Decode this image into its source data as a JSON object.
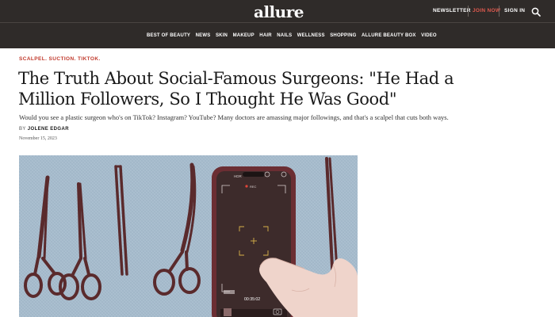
{
  "header": {
    "logo": "allure",
    "newsletter_label": "NEWSLETTER",
    "join_label": "JOIN NOW",
    "signin_label": "SIGN IN"
  },
  "nav": {
    "items": [
      "BEST OF BEAUTY",
      "NEWS",
      "SKIN",
      "MAKEUP",
      "HAIR",
      "NAILS",
      "WELLNESS",
      "SHOPPING",
      "ALLURE BEAUTY BOX",
      "VIDEO"
    ]
  },
  "article": {
    "kicker": "SCALPEL. SUCTION. TIKTOK.",
    "headline": "The Truth About Social-Famous Surgeons: \"He Had a Million Followers, So I Thought He Was Good\"",
    "dek": "Would you see a plastic surgeon who's on TikTok? Instagram? YouTube? Many doctors are amassing major followings, and that's a scalpel that cuts both ways.",
    "byline_prefix": "BY",
    "author": "JOLENE EDGAR",
    "date": "November 15, 2023"
  },
  "hero": {
    "phone_hdr_label": "HDR",
    "rec_label": "REC",
    "timer": "00:35:02"
  },
  "colors": {
    "header_bg": "#2f2b29",
    "accent_red": "#c0392b",
    "join_red": "#e05a4f",
    "drape_blue": "#a7bccd",
    "instrument": "#5a2a2c"
  },
  "icons": [
    "search-icon",
    "record-dot-icon",
    "focus-frame-icon",
    "camera-icon"
  ]
}
